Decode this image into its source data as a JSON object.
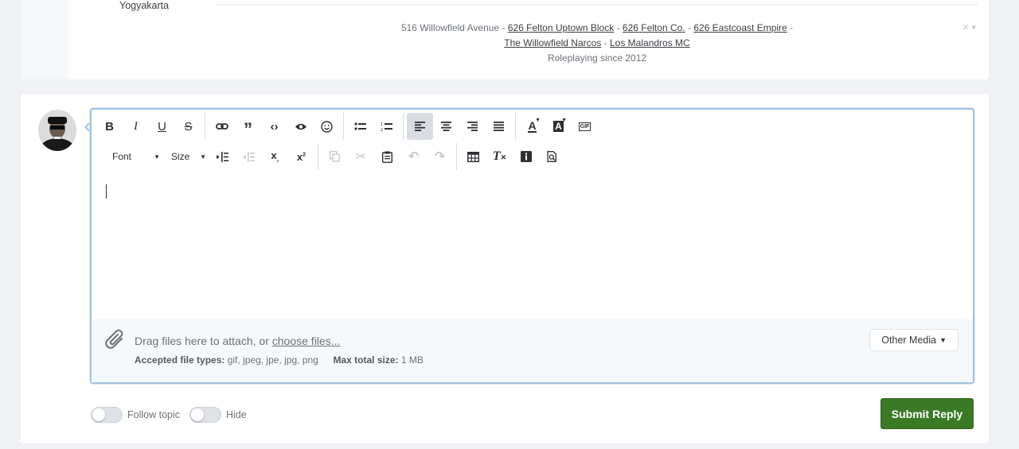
{
  "previous_post": {
    "location": "Yogyakarta",
    "signature": {
      "address": "516 Willowfield Avenue",
      "separator": "-",
      "links": [
        "626 Felton Uptown Block",
        "626 Felton Co.",
        "626 Eastcoast Empire",
        "The Willowfield Narcos",
        "Los Malandros MC"
      ],
      "tagline": "Roleplaying since 2012"
    }
  },
  "editor": {
    "toolbar": {
      "font_label": "Font",
      "size_label": "Size",
      "gif_label": "GIF"
    },
    "attachments": {
      "drag_text": "Drag files here to attach, or",
      "choose_link": "choose files...",
      "accepted_label": "Accepted file types:",
      "accepted_value": "gif, jpeg, jpe, jpg, png",
      "max_label": "Max total size:",
      "max_value": "1 MB",
      "other_media_label": "Other Media"
    }
  },
  "options": {
    "follow_label": "Follow topic",
    "hide_label": "Hide"
  },
  "submit_label": "Submit Reply",
  "colors": {
    "accent_green": "#3b7a25",
    "editor_border": "#a3c2de",
    "page_bg": "#eff1f4"
  }
}
